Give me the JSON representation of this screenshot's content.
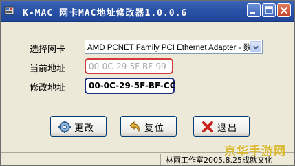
{
  "window": {
    "title": "K-MAC 网卡MAC地址修改器1.0.0.6"
  },
  "form": {
    "nic_label": "选择网卡",
    "nic_selected": "AMD PCNET Family PCI Ethernet Adapter - 数据包",
    "current_label": "当前地址",
    "current_value": "00-0C-29-5F-BF-99",
    "modify_label": "修改地址",
    "modify_value": "00-0C-29-5F-BF-CC"
  },
  "buttons": {
    "change": "更改",
    "restore": "复位",
    "exit": "退出"
  },
  "status": {
    "text": "林雨工作室2005.8.25成就文化"
  },
  "watermark": "京华手游网",
  "colors": {
    "current_field_border": "#d23b3b",
    "modify_field_border": "#1d2d80",
    "titlebar": "#2a52a6",
    "watermark": "#d8b21e"
  },
  "icons": [
    "app-icon",
    "minimize-icon",
    "maximize-icon",
    "close-icon",
    "dropdown-arrow-icon",
    "change-gear-icon",
    "restore-arrow-icon",
    "exit-x-icon"
  ]
}
